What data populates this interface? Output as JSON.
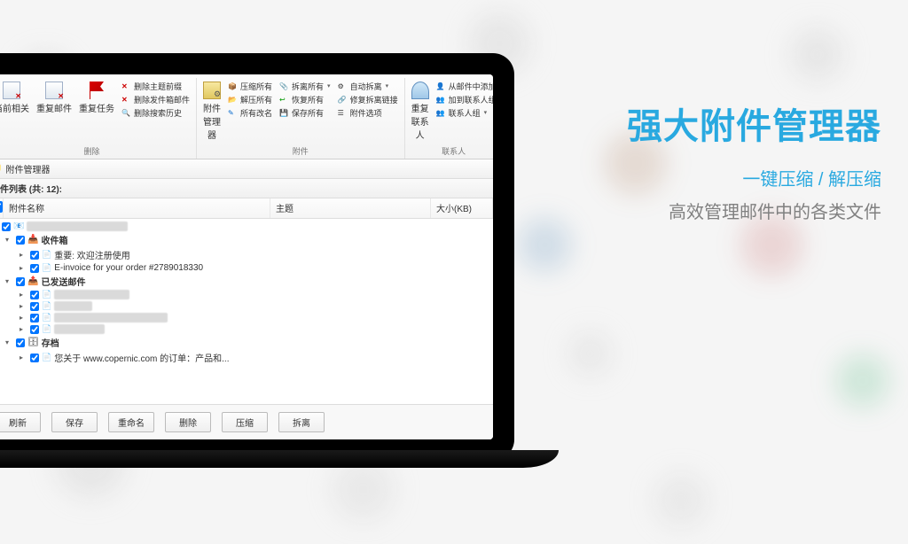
{
  "ribbon": {
    "groups": {
      "delete": {
        "label": "删除",
        "big": {
          "related": "当前相关",
          "dup_mail": "重复邮件",
          "dup_task": "重复任务"
        },
        "small": {
          "del_before": "删除主题前缀",
          "del_sender": "删除发件箱邮件",
          "del_history": "删除搜索历史"
        }
      },
      "attachment": {
        "label": "附件",
        "big": "附件\n管理器",
        "col1": {
          "compress": "压缩所有",
          "decompress": "解压所有",
          "rename": "所有改名"
        },
        "col2": {
          "detach": "拆离所有",
          "restore": "恢复所有",
          "save": "保存所有"
        },
        "col3": {
          "auto": "自动拆离",
          "fixlink": "修复拆离链接",
          "options": "附件选项"
        }
      },
      "contacts": {
        "label": "联系人",
        "big": "重复\n联系人",
        "items": {
          "from_mail": "从邮件中添加",
          "add_to": "加到联系人组",
          "groups": "联系人组"
        }
      }
    }
  },
  "manager": {
    "window_title": "附件管理器",
    "list_header_prefix": "附件列表 (共: ",
    "list_count": "12",
    "list_header_suffix": "):",
    "columns": {
      "name": "附件名称",
      "subject": "主题",
      "size": "大小(KB)"
    },
    "tree": {
      "root_blur": "████████████",
      "inbox": "收件箱",
      "inbox_items": [
        "重要: 欢迎注册使用",
        "E-invoice for your order #2789018330"
      ],
      "sent": "已发送邮件",
      "archive": "存档",
      "archive_item": "您关于 www.copernic.com 的订单：产品和..."
    },
    "buttons": {
      "refresh": "刷新",
      "save": "保存",
      "rename": "重命名",
      "delete": "删除",
      "compress": "压缩",
      "detach": "拆离"
    }
  },
  "promo": {
    "title": "强大附件管理器",
    "sub1": "一键压缩 / 解压缩",
    "sub2": "高效管理邮件中的各类文件"
  }
}
